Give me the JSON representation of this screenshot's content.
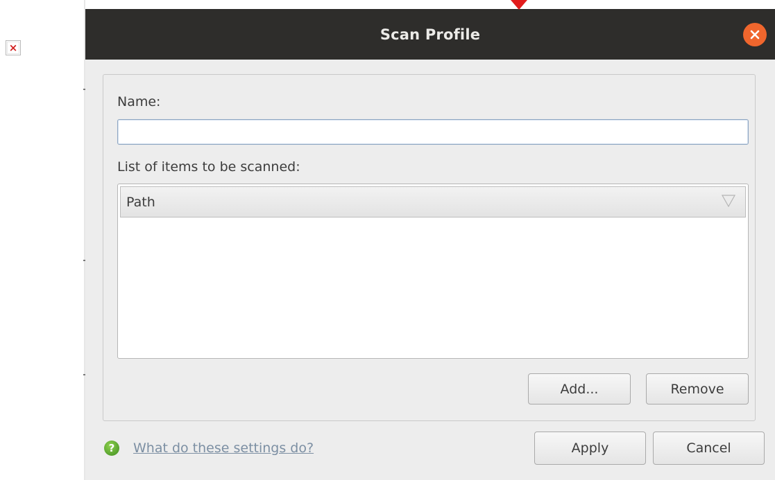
{
  "dialog": {
    "title": "Scan Profile",
    "name_label": "Name:",
    "name_value": "",
    "name_placeholder": "",
    "list_label": "List of items to be scanned:",
    "list_columns": [
      "Path"
    ],
    "list_rows": [],
    "add_label": "Add...",
    "remove_label": "Remove",
    "help_link": "What do these settings do?",
    "apply_label": "Apply",
    "cancel_label": "Cancel"
  },
  "icons": {
    "close": "close-icon",
    "help": "help-icon",
    "sort": "sort-descending-icon",
    "broken_image": "broken-image-icon",
    "pointer": "pointer-arrow-icon"
  },
  "colors": {
    "titlebar": "#2e2d2b",
    "close_button": "#f0662d",
    "pointer": "#e21c1c",
    "help_icon": "#4a9e24",
    "link": "#7c8fa3"
  }
}
